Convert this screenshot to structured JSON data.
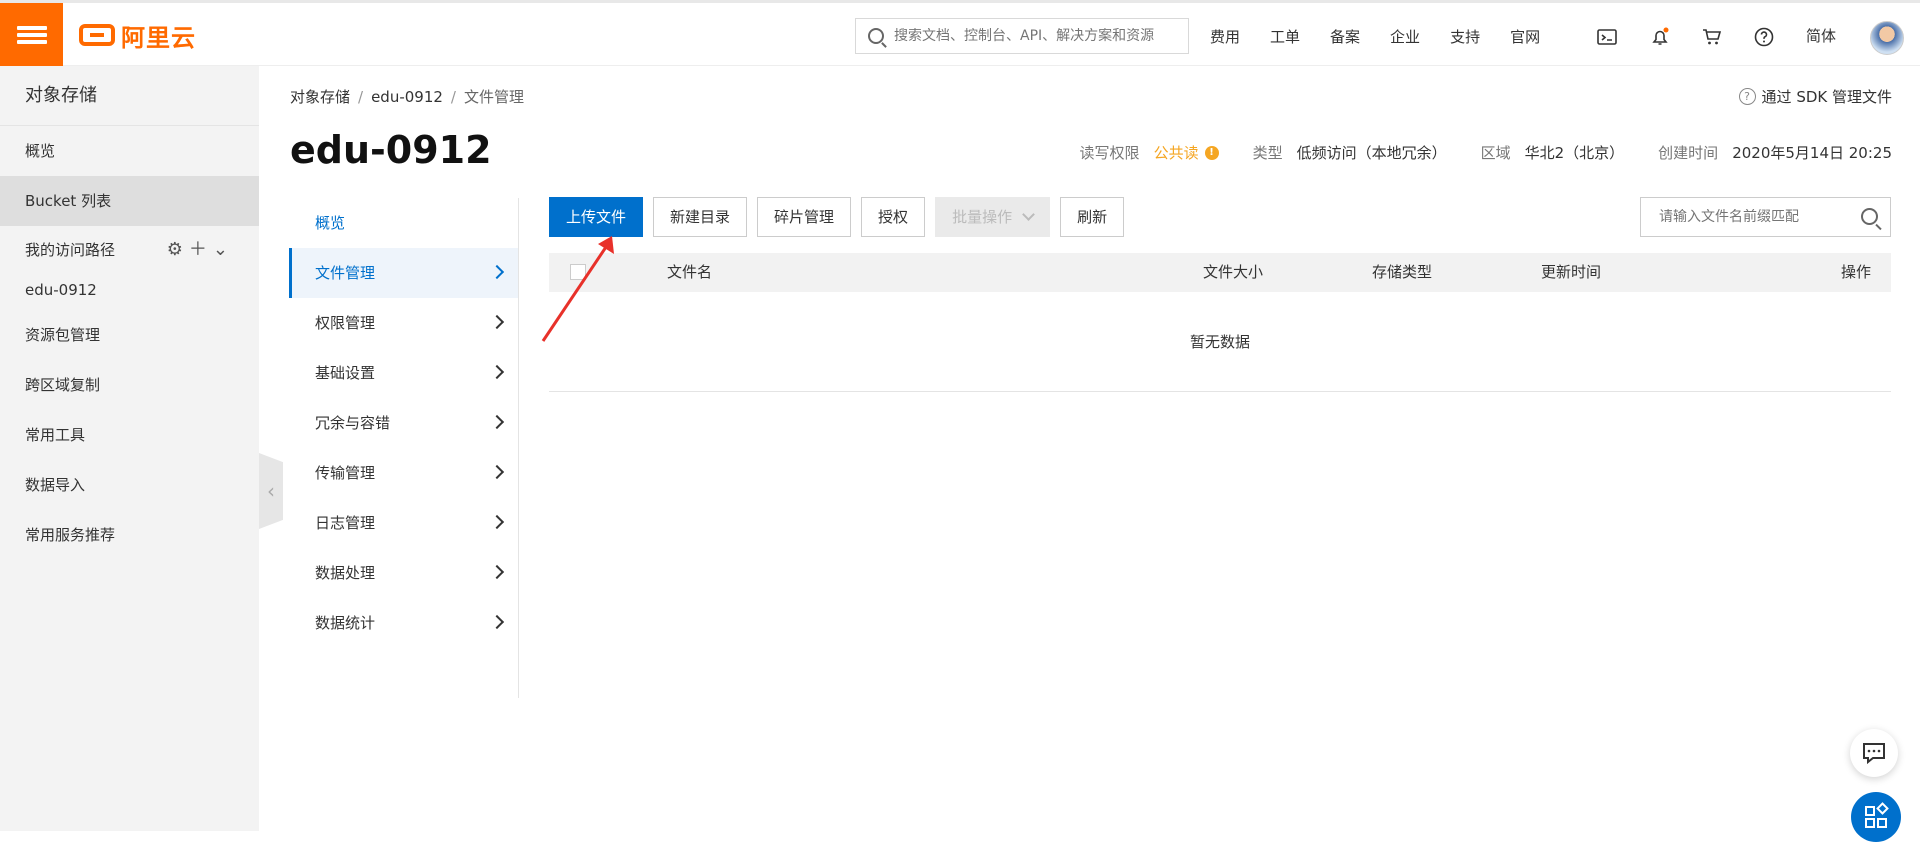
{
  "header": {
    "logo_text": "阿里云",
    "search_placeholder": "搜索文档、控制台、API、解决方案和资源",
    "links": [
      "费用",
      "工单",
      "备案",
      "企业",
      "支持",
      "官网"
    ],
    "lang": "简体",
    "notification_dot_color": "#ff6a00"
  },
  "sidebar": {
    "title": "对象存储",
    "items": [
      {
        "label": "概览"
      },
      {
        "label": "Bucket 列表",
        "active": true
      }
    ],
    "access_path": {
      "label": "我的访问路径",
      "bucket": "edu-0912"
    },
    "more_items": [
      "资源包管理",
      "跨区域复制",
      "常用工具",
      "数据导入",
      "常用服务推荐"
    ]
  },
  "breadcrumb": [
    "对象存储",
    "edu-0912",
    "文件管理"
  ],
  "sdk_link": "通过 SDK 管理文件",
  "bucket": {
    "name": "edu-0912",
    "acl_label": "读写权限",
    "acl_value": "公共读",
    "type_label": "类型",
    "type_value": "低频访问（本地冗余）",
    "region_label": "区域",
    "region_value": "华北2（北京）",
    "created_label": "创建时间",
    "created_value": "2020年5月14日 20:25"
  },
  "subnav": [
    {
      "label": "概览"
    },
    {
      "label": "文件管理",
      "active": true
    },
    {
      "label": "权限管理"
    },
    {
      "label": "基础设置"
    },
    {
      "label": "冗余与容错"
    },
    {
      "label": "传输管理"
    },
    {
      "label": "日志管理"
    },
    {
      "label": "数据处理"
    },
    {
      "label": "数据统计"
    }
  ],
  "toolbar": {
    "upload": "上传文件",
    "new_dir": "新建目录",
    "fragments": "碎片管理",
    "authorize": "授权",
    "batch": "批量操作",
    "refresh": "刷新",
    "filter_placeholder": "请输入文件名前缀匹配"
  },
  "table": {
    "columns": [
      "文件名",
      "文件大小",
      "存储类型",
      "更新时间",
      "操作"
    ],
    "empty_text": "暂无数据"
  },
  "colors": {
    "brand": "#ff6a00",
    "primary": "#0070cc",
    "warning": "#f5a623",
    "arrow": "#e8312a"
  }
}
